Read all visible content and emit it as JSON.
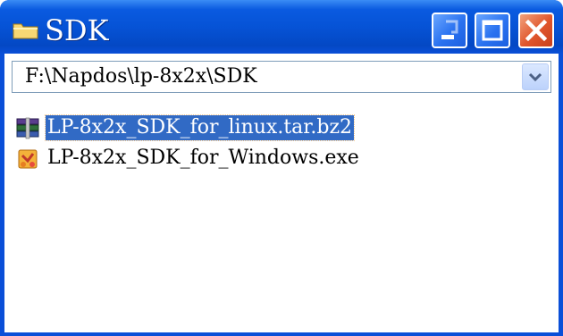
{
  "window": {
    "title": "SDK",
    "title_icon": "folder-icon",
    "controls": {
      "minimize": "minimize-icon",
      "maximize": "maximize-icon",
      "close": "close-icon"
    }
  },
  "address": {
    "path": "F:\\Napdos\\lp-8x2x\\SDK",
    "dropdown_icon": "chevron-down-icon"
  },
  "files": [
    {
      "name": "LP-8x2x_SDK_for_linux.tar.bz2",
      "icon": "archive-icon",
      "selected": true
    },
    {
      "name": "LP-8x2x_SDK_for_Windows.exe",
      "icon": "installer-icon",
      "selected": false
    }
  ],
  "colors": {
    "titlebar": "#0653d6",
    "selection": "#316ac5",
    "close_button": "#e0552c"
  }
}
